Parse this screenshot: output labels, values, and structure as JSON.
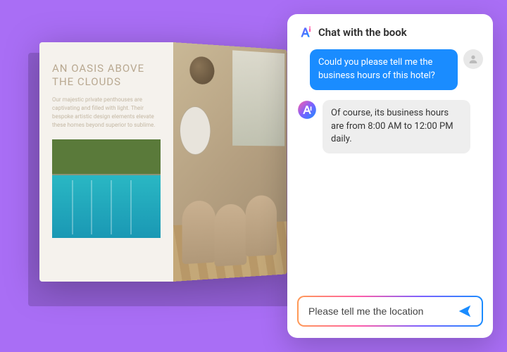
{
  "book": {
    "heading": "AN OASIS ABOVE THE CLOUDS",
    "body": "Our majestic private penthouses are captivating and filled with light. Their bespoke artistic design elements elevate these homes beyond superior to sublime."
  },
  "chat": {
    "title": "Chat with the book",
    "messages": [
      {
        "role": "user",
        "text": "Could you please tell me the business hours of this hotel?"
      },
      {
        "role": "ai",
        "text": "Of course, its business hours are from 8:00 AM to 12:00 PM daily."
      }
    ],
    "input_value": "Please tell me the location"
  },
  "icons": {
    "ai_logo": "ai-logo",
    "user_avatar": "user-avatar-icon",
    "send": "send-icon"
  },
  "colors": {
    "background": "#a96ef5",
    "user_bubble": "#1a8cff",
    "ai_bubble": "#eeeeee"
  }
}
